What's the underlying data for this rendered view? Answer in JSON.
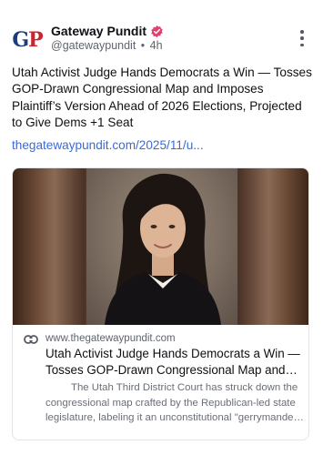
{
  "author": {
    "logo_text_g": "G",
    "logo_text_p": "P",
    "name": "Gateway Pundit",
    "handle": "@gatewaypundit",
    "separator": "•",
    "time": "4h"
  },
  "post": {
    "text": "Utah Activist Judge Hands Democrats a Win — Tosses GOP-Drawn Congressional Map and Imposes Plaintiff’s Version Ahead of 2026 Elections, Projected to Give Dems +1 Seat",
    "link": "thegatewaypundit.com/2025/11/u..."
  },
  "card": {
    "domain": "www.thegatewaypundit.com",
    "title": "Utah Activist Judge Hands Democrats a Win — Tosses GOP-Drawn Congressional Map and Im...",
    "description": "The Utah Third District Court has struck down the congressional map crafted by the Republican-led state legislature, labeling it an unconstitutional \"gerrymander\" and replacing it with a map drawn by l..."
  },
  "colors": {
    "link": "#3b6bd8",
    "verified_badge": "#e4406f",
    "logo_blue": "#1d3d7a",
    "logo_red": "#c8262f"
  },
  "icons": {
    "verified": "verified-badge-icon",
    "more": "more-vertical-icon",
    "link": "link-icon"
  }
}
